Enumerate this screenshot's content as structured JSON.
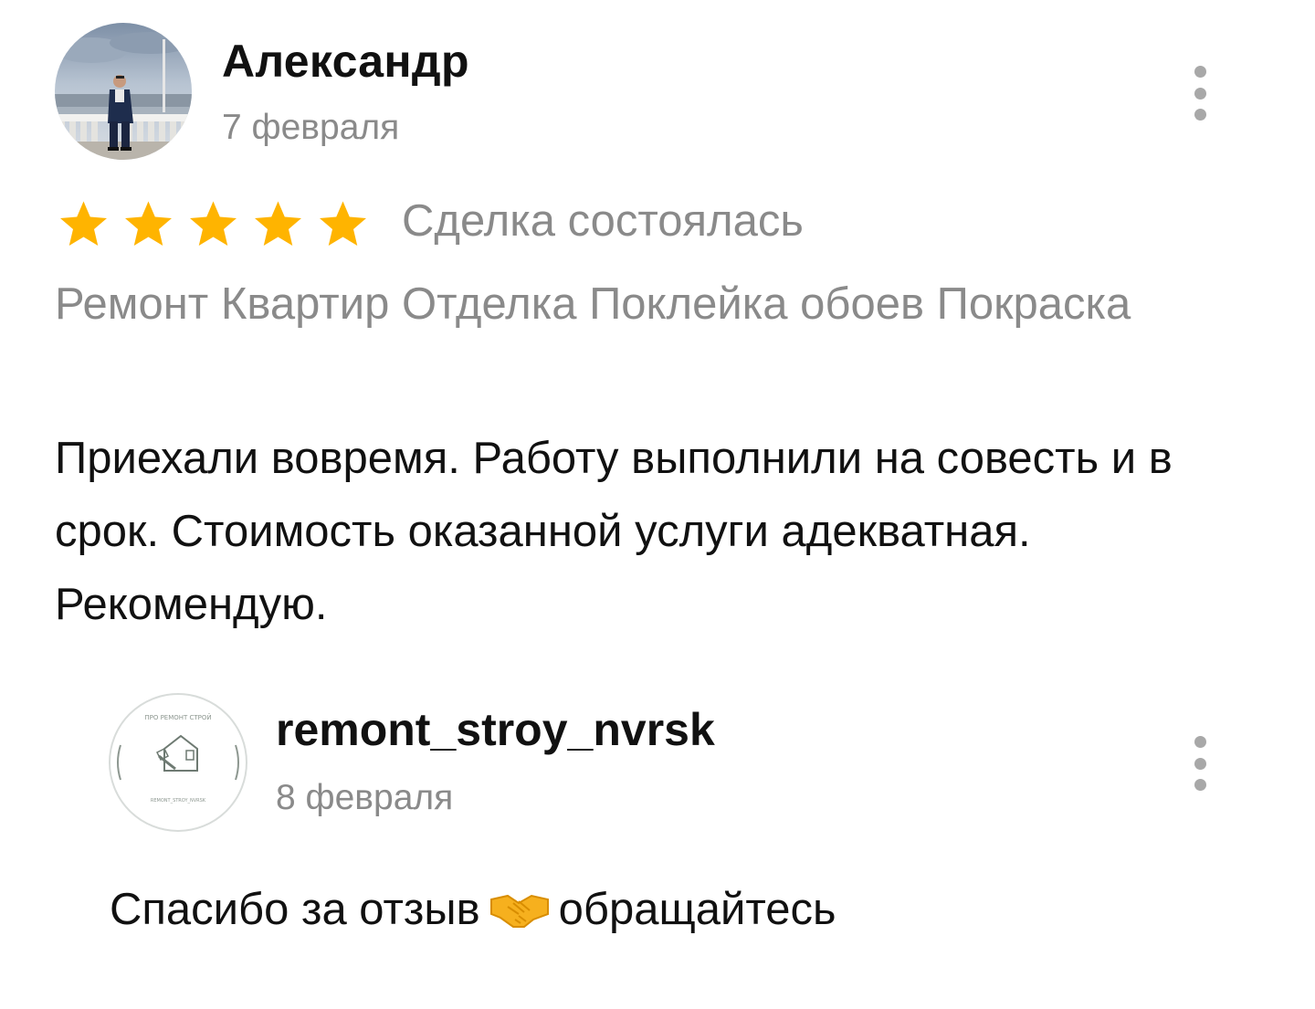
{
  "review": {
    "author": {
      "name": "Александр",
      "date": "7 февраля",
      "avatar": "user-photo"
    },
    "rating": {
      "value": 5,
      "max": 5,
      "color": "#ffb400"
    },
    "status": "Сделка состоялась",
    "tags": "Ремонт Квартир Отделка Поклейка обоев Покраска",
    "text": "Приехали вовремя. Работу выполнили на совесть и в срок. Стоимость оказанной услуги адекватная. Рекомендую.",
    "menu_icon": "more-vertical-icon"
  },
  "reply": {
    "author": {
      "name": "remont_stroy_nvrsk",
      "date": "8 февраля",
      "avatar": "company-logo",
      "logo_top_text": "ПРО РЕМОНТ СТРОЙ",
      "logo_bottom_text": "REMONT_STROY_NVRSK"
    },
    "text_before": "Спасибо за отзыв",
    "emoji": "handshake-icon",
    "text_after": "обращайтесь",
    "menu_icon": "more-vertical-icon"
  },
  "colors": {
    "primary_text": "#111111",
    "secondary_text": "#8a8a8a",
    "star": "#ffb400",
    "menu_dots": "#a8a8a8"
  }
}
